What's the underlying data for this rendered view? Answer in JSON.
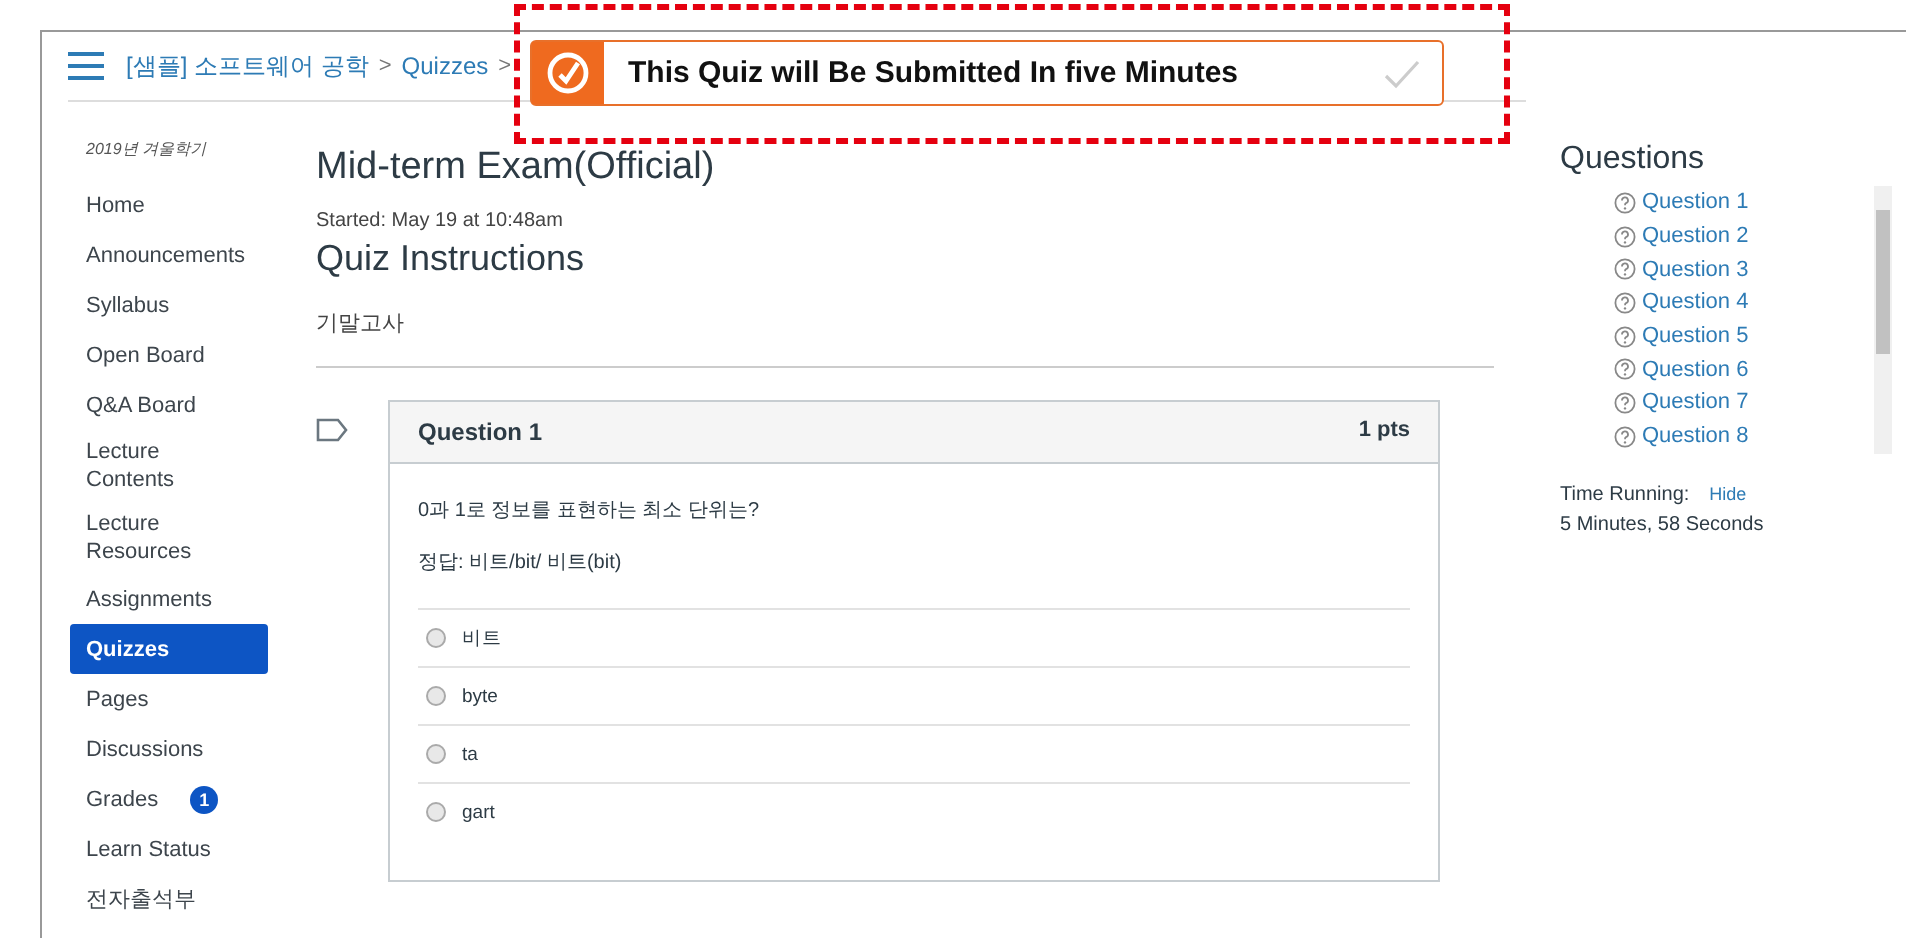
{
  "header": {
    "breadcrumb": [
      "[샘플] 소프트웨어 공학",
      "Quizzes"
    ],
    "separator": ">"
  },
  "notification": {
    "message": "This Quiz will Be Submitted In five Minutes"
  },
  "sidebar": {
    "term": "2019년 겨울학기",
    "items": [
      {
        "label": "Home",
        "selected": false
      },
      {
        "label": "Announcements",
        "selected": false
      },
      {
        "label": "Syllabus",
        "selected": false
      },
      {
        "label": "Open Board",
        "selected": false
      },
      {
        "label": "Q&A Board",
        "selected": false
      },
      {
        "label": "Lecture Contents",
        "selected": false
      },
      {
        "label": "Lecture Resources",
        "selected": false
      },
      {
        "label": "Assignments",
        "selected": false
      },
      {
        "label": "Quizzes",
        "selected": true
      },
      {
        "label": "Pages",
        "selected": false
      },
      {
        "label": "Discussions",
        "selected": false
      },
      {
        "label": "Grades",
        "selected": false,
        "badge": "1"
      },
      {
        "label": "Learn Status",
        "selected": false
      },
      {
        "label": "전자출석부",
        "selected": false
      }
    ]
  },
  "quiz": {
    "title": "Mid-term Exam(Official)",
    "started": "Started: May 19 at 10:48am",
    "instructions_heading": "Quiz Instructions",
    "instructions": "기말고사",
    "question": {
      "title": "Question 1",
      "points": "1 pts",
      "text": "0과 1로 정보를 표현하는 최소 단위는?",
      "note": "정답: 비트/bit/ 비트(bit)",
      "options": [
        {
          "label": "비트",
          "selected": false
        },
        {
          "label": "byte",
          "selected": false
        },
        {
          "label": "ta",
          "selected": false
        },
        {
          "label": "gart",
          "selected": false
        }
      ]
    }
  },
  "questions_panel": {
    "title": "Questions",
    "items": [
      "Question 1",
      "Question 2",
      "Question 3",
      "Question 4",
      "Question 5",
      "Question 6",
      "Question 7",
      "Question 8"
    ],
    "timer_label": "Time Running:",
    "hide_link": "Hide",
    "time": "5 Minutes, 58 Seconds"
  }
}
